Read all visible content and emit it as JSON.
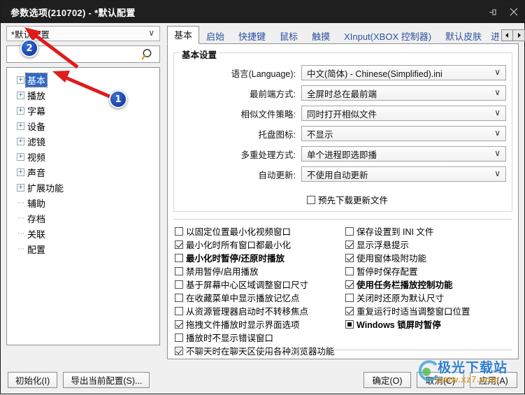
{
  "window": {
    "title": "参数选项(210702) - *默认配置",
    "pin_icon": "pin-icon",
    "close_icon": "close-icon"
  },
  "sidebar": {
    "profile_combo": {
      "value": "*默认配置",
      "arrow": "∨"
    },
    "search": {
      "value": "",
      "placeholder": "",
      "icon": "search-icon"
    },
    "tree": [
      {
        "label": "基本",
        "expandable": true,
        "selected": true
      },
      {
        "label": "播放",
        "expandable": true,
        "selected": false
      },
      {
        "label": "字幕",
        "expandable": true,
        "selected": false
      },
      {
        "label": "设备",
        "expandable": true,
        "selected": false
      },
      {
        "label": "滤镜",
        "expandable": true,
        "selected": false
      },
      {
        "label": "视频",
        "expandable": true,
        "selected": false
      },
      {
        "label": "声音",
        "expandable": true,
        "selected": false
      },
      {
        "label": "扩展功能",
        "expandable": true,
        "selected": false
      },
      {
        "label": "辅助",
        "expandable": false,
        "selected": false
      },
      {
        "label": "存档",
        "expandable": false,
        "selected": false
      },
      {
        "label": "关联",
        "expandable": false,
        "selected": false
      },
      {
        "label": "配置",
        "expandable": false,
        "selected": false
      }
    ]
  },
  "tabs": [
    {
      "label": "基本",
      "active": true
    },
    {
      "label": "启始",
      "active": false
    },
    {
      "label": "快捷键",
      "active": false
    },
    {
      "label": "鼠标",
      "active": false
    },
    {
      "label": "触摸",
      "active": false
    },
    {
      "label": "XInput(XBOX 控制器)",
      "active": false
    },
    {
      "label": "默认皮肤",
      "active": false
    },
    {
      "label": "进",
      "active": false,
      "clipped": true
    }
  ],
  "tab_scroll": {
    "left": "◄",
    "right": "►"
  },
  "settings": {
    "group_title": "基本设置",
    "fields": [
      {
        "label": "语言(Language):",
        "value": "中文(简体) - Chinese(Simplified).ini",
        "arrow": "∨"
      },
      {
        "label": "最前端方式:",
        "value": "全屏时总在最前端",
        "arrow": "∨"
      },
      {
        "label": "相似文件策略:",
        "value": "同时打开相似文件",
        "arrow": "∨"
      },
      {
        "label": "托盘图标:",
        "value": "不显示",
        "arrow": "∨"
      },
      {
        "label": "多重处理方式:",
        "value": "单个进程即选即播",
        "arrow": "∨"
      },
      {
        "label": "自动更新:",
        "value": "不使用自动更新",
        "arrow": "∨"
      }
    ],
    "prefetch": {
      "label": "预先下载更新文件",
      "state": "unchecked"
    }
  },
  "checkboxes_left": [
    {
      "label": "以固定位置最小化视频窗口",
      "state": "unchecked",
      "bold": false
    },
    {
      "label": "最小化时所有窗口都最小化",
      "state": "checked",
      "bold": false
    },
    {
      "label": "最小化时暂停/还原时播放",
      "state": "unchecked",
      "bold": true
    },
    {
      "label": "禁用暂停/启用播放",
      "state": "unchecked",
      "bold": false
    },
    {
      "label": "基于屏幕中心区域调整窗口尺寸",
      "state": "unchecked",
      "bold": false
    },
    {
      "label": "在收藏菜单中显示播放记忆点",
      "state": "unchecked",
      "bold": false
    },
    {
      "label": "从资源管理器启动时不转移焦点",
      "state": "unchecked",
      "bold": false
    },
    {
      "label": "拖拽文件播放时显示界面选项",
      "state": "checked",
      "bold": false
    },
    {
      "label": "播放时不显示错误窗口",
      "state": "unchecked",
      "bold": false
    },
    {
      "label": "不聊天时在聊天区使用各种浏览器功能",
      "state": "checked",
      "bold": false
    }
  ],
  "checkboxes_right": [
    {
      "label": "保存设置到 INI 文件",
      "state": "unchecked",
      "bold": false
    },
    {
      "label": "显示浮悬提示",
      "state": "checked",
      "bold": false
    },
    {
      "label": "使用窗体吸附功能",
      "state": "checked",
      "bold": false
    },
    {
      "label": "暂停时保存配置",
      "state": "unchecked",
      "bold": false
    },
    {
      "label": "使用任务栏播放控制功能",
      "state": "checked",
      "bold": true
    },
    {
      "label": "关闭时还原为默认尺寸",
      "state": "unchecked",
      "bold": false
    },
    {
      "label": "重复运行时适当调整窗口位置",
      "state": "checked",
      "bold": false
    },
    {
      "label": "Windows 锁屏时暂停",
      "state": "filled",
      "bold": true
    }
  ],
  "footer": {
    "init_button": "初始化(I)",
    "export_button": "导出当前配置(S)...",
    "ok_button": "确定(O)",
    "cancel_button": "取消(C)",
    "apply_button": "应用(A)"
  },
  "annotations": {
    "badge1": "1",
    "badge2": "2"
  },
  "watermark": {
    "title": "极光下载站",
    "url": "www.xz7.com"
  },
  "colors": {
    "titlebar": "#1f1f1f",
    "tab_text": "#2b4f9e",
    "selection": "#316ac5",
    "arrow_red": "#e01b1b",
    "badge_blue": "#123bb0"
  }
}
